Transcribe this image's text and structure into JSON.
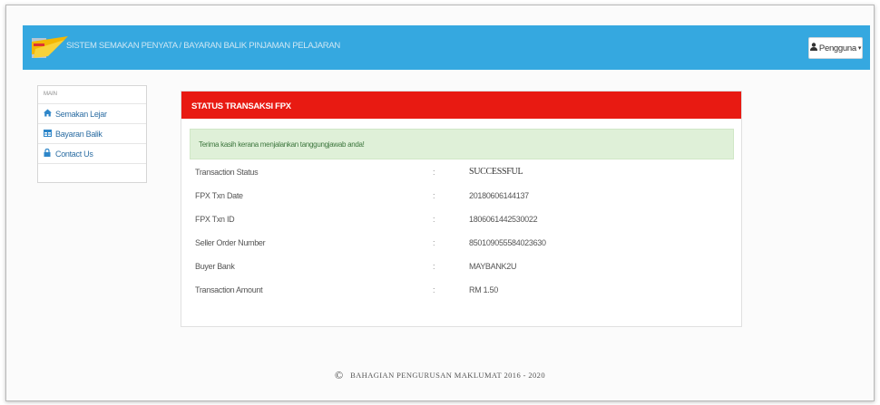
{
  "header": {
    "brand_text": "SISTEM SEMAKAN PENYATA / BAYARAN BALIK PINJAMAN PELAJARAN",
    "user_menu_label": "Pengguna",
    "accent_color": "#35a8e0"
  },
  "sidebar": {
    "title": "MAIN",
    "items": [
      {
        "label": "Semakan Lejar",
        "icon": "home-icon"
      },
      {
        "label": "Bayaran Balik",
        "icon": "table-icon"
      },
      {
        "label": "Contact Us",
        "icon": "lock-icon"
      }
    ]
  },
  "panel": {
    "title": "STATUS TRANSAKSI FPX",
    "header_color": "#e81a12",
    "alert_text": "Terima kasih kerana menjalankan tanggungjawab anda!",
    "alert_color": "#dff0d8",
    "rows": [
      {
        "label": "Transaction Status",
        "separator": ":",
        "value": "SUCCESSFUL"
      },
      {
        "label": "FPX Txn Date",
        "separator": ":",
        "value": "20180606144137"
      },
      {
        "label": "FPX Txn ID",
        "separator": ":",
        "value": "1806061442530022"
      },
      {
        "label": "Seller Order Number",
        "separator": ":",
        "value": "850109055584023630"
      },
      {
        "label": "Buyer Bank",
        "separator": ":",
        "value": "MAYBANK2U"
      },
      {
        "label": "Transaction Amount",
        "separator": ":",
        "value": "RM 1.50"
      }
    ]
  },
  "footer": {
    "symbol": "©",
    "text": "BAHAGIAN PENGURUSAN MAKLUMAT 2016 - 2020"
  }
}
